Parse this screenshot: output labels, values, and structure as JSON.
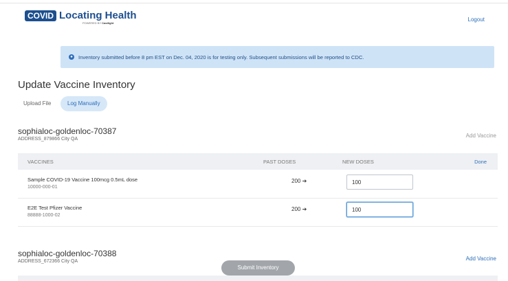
{
  "header": {
    "logo_badge": "COVID",
    "logo_title": "Locating Health",
    "logo_powered": "POWERED BY",
    "logo_brand": "Castlight",
    "logout": "Logout"
  },
  "banner": {
    "icon": "info-icon",
    "text": "Inventory submitted before 8 pm EST on Dec. 04, 2020 is for testing only. Subsequent submissions will be reported to CDC."
  },
  "page": {
    "title": "Update Vaccine Inventory"
  },
  "tabs": [
    {
      "label": "Upload File",
      "active": false
    },
    {
      "label": "Log Manually",
      "active": true
    }
  ],
  "locations": [
    {
      "name": "sophialoc-goldenloc-70387",
      "address": "ADDRESS_879866 City QA",
      "add_vaccine": "Add Vaccine",
      "table": {
        "headers": {
          "vaccines": "VACCINES",
          "past": "PAST DOSES",
          "new": "NEW DOSES",
          "done": "Done"
        },
        "rows": [
          {
            "name": "Sample COVID-19 Vaccine 100mcg 0.5mL dose",
            "code": "10000-000-01",
            "past": "200",
            "new": "100"
          },
          {
            "name": "E2E Test Pfizer Vaccine",
            "code": "88888-1000-02",
            "past": "200",
            "new": "100"
          }
        ]
      }
    },
    {
      "name": "sophialoc-goldenloc-70388",
      "address": "ADDRESS_672366 City QA",
      "add_vaccine": "Add Vaccine"
    }
  ],
  "submit": {
    "label": "Submit Inventory"
  },
  "colors": {
    "accent": "#2e6fba",
    "banner_bg": "#cfe3f7",
    "submit_bg": "#a2a6ab"
  }
}
